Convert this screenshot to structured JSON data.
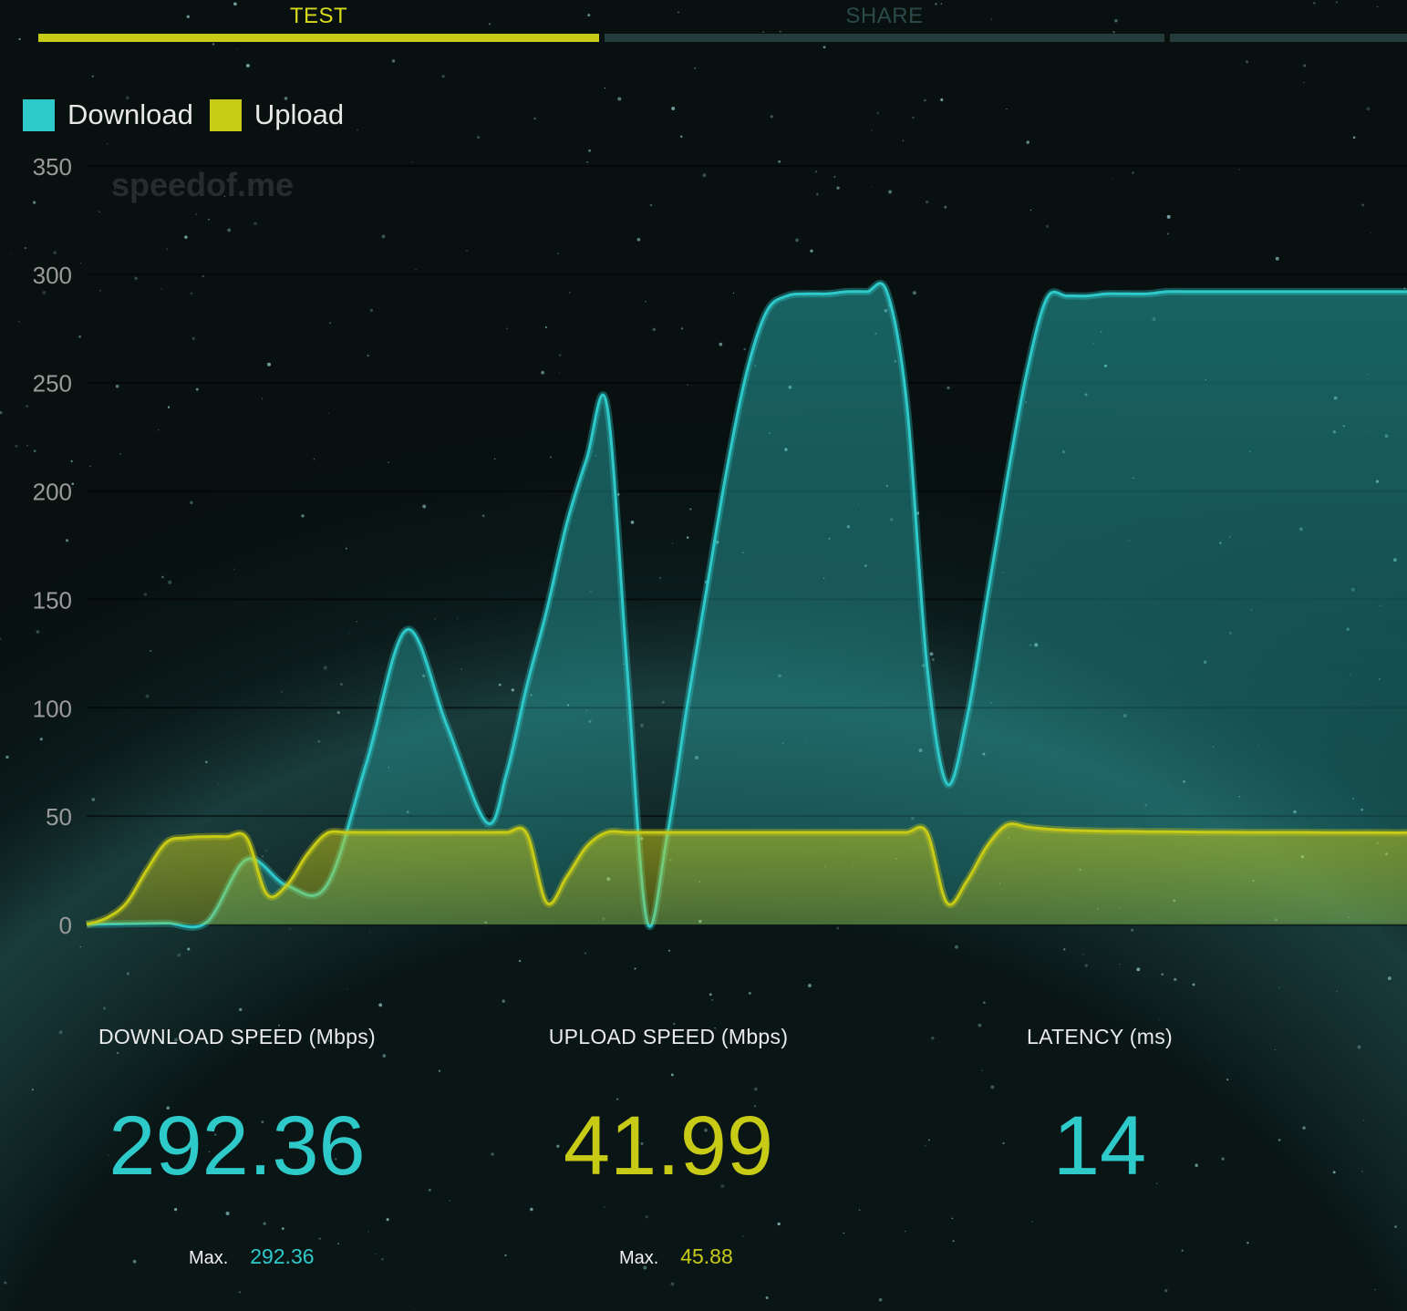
{
  "tabs": [
    {
      "label": "TEST",
      "active": true
    },
    {
      "label": "SHARE",
      "active": false
    },
    {
      "label": "",
      "active": false
    }
  ],
  "colors": {
    "download": "#2ec9c9",
    "upload": "#c8cb16",
    "inactive_tab": "#243c3c",
    "inactive_tab_text": "#2c4a4a"
  },
  "legend": [
    {
      "label": "Download",
      "color": "#2ec9c9"
    },
    {
      "label": "Upload",
      "color": "#c8cb16"
    }
  ],
  "watermark": "speedof.me",
  "chart_data": {
    "type": "area",
    "ylim": [
      0,
      350
    ],
    "yticks": [
      "0",
      "50",
      "100",
      "150",
      "200",
      "250",
      "300",
      "350"
    ],
    "grid": true,
    "legend_placement": "top-left",
    "series": [
      {
        "name": "Download",
        "color": "#2ec9c9",
        "x": [
          0,
          10,
          20,
          30,
          40,
          50,
          60,
          70,
          80,
          90,
          100,
          105,
          110,
          115,
          120,
          125,
          130,
          135,
          140,
          145,
          150,
          155,
          160,
          165,
          170,
          175,
          180,
          185,
          190,
          195,
          200,
          205,
          210,
          215,
          220,
          225,
          230,
          235,
          240,
          245,
          250,
          255,
          260,
          265,
          270,
          275,
          280,
          285,
          290,
          295,
          300,
          305,
          310,
          315,
          320,
          325,
          330
        ],
        "values": [
          0,
          0.3,
          0.6,
          1,
          30,
          18,
          18,
          75,
          136,
          92,
          47,
          70,
          110,
          145,
          185,
          215,
          240,
          120,
          2,
          40,
          100,
          155,
          210,
          255,
          283,
          290,
          291,
          291,
          292,
          292,
          292,
          240,
          120,
          65,
          95,
          150,
          205,
          255,
          289,
          290,
          290,
          291,
          291,
          291,
          292,
          292,
          292,
          292,
          292,
          292,
          292,
          292,
          292,
          292,
          292,
          292,
          292
        ]
      },
      {
        "name": "Upload",
        "color": "#c8cb16",
        "x": [
          0,
          5,
          10,
          15,
          20,
          25,
          30,
          35,
          40,
          45,
          50,
          55,
          60,
          65,
          70,
          75,
          80,
          85,
          90,
          95,
          100,
          105,
          110,
          115,
          120,
          125,
          130,
          135,
          140,
          145,
          150,
          155,
          160,
          165,
          170,
          175,
          180,
          185,
          190,
          195,
          200,
          205,
          210,
          215,
          220,
          225,
          230,
          235,
          240,
          245,
          250,
          255,
          260,
          265,
          270,
          275,
          280,
          285,
          290,
          295,
          300,
          305,
          310,
          315,
          320,
          325,
          330
        ],
        "values": [
          0,
          3,
          10,
          25,
          38,
          40,
          40.5,
          40.5,
          40,
          14,
          18,
          32,
          42,
          42.5,
          42.5,
          42.5,
          42.5,
          42.5,
          42.5,
          42.5,
          42.5,
          42.5,
          42,
          10,
          22,
          36,
          42.5,
          42.5,
          42.5,
          42.5,
          42.5,
          42.5,
          42.5,
          42.5,
          42.5,
          42.5,
          42.5,
          42.5,
          42.5,
          42.5,
          42.5,
          42.5,
          42.5,
          10,
          20,
          36,
          45.9,
          45,
          44,
          43.5,
          43.2,
          43,
          43,
          42.8,
          42.8,
          42.7,
          42.6,
          42.6,
          42.5,
          42.5,
          42.5,
          42.5,
          42.4,
          42.4,
          42.4,
          42.3,
          42.3
        ]
      }
    ]
  },
  "stats": {
    "download": {
      "title": "DOWNLOAD SPEED (Mbps)",
      "value": "292.36",
      "max_label": "Max.",
      "max_value": "292.36"
    },
    "upload": {
      "title": "UPLOAD SPEED (Mbps)",
      "value": "41.99",
      "max_label": "Max.",
      "max_value": "45.88"
    },
    "latency": {
      "title": "LATENCY (ms)",
      "value": "14"
    }
  }
}
